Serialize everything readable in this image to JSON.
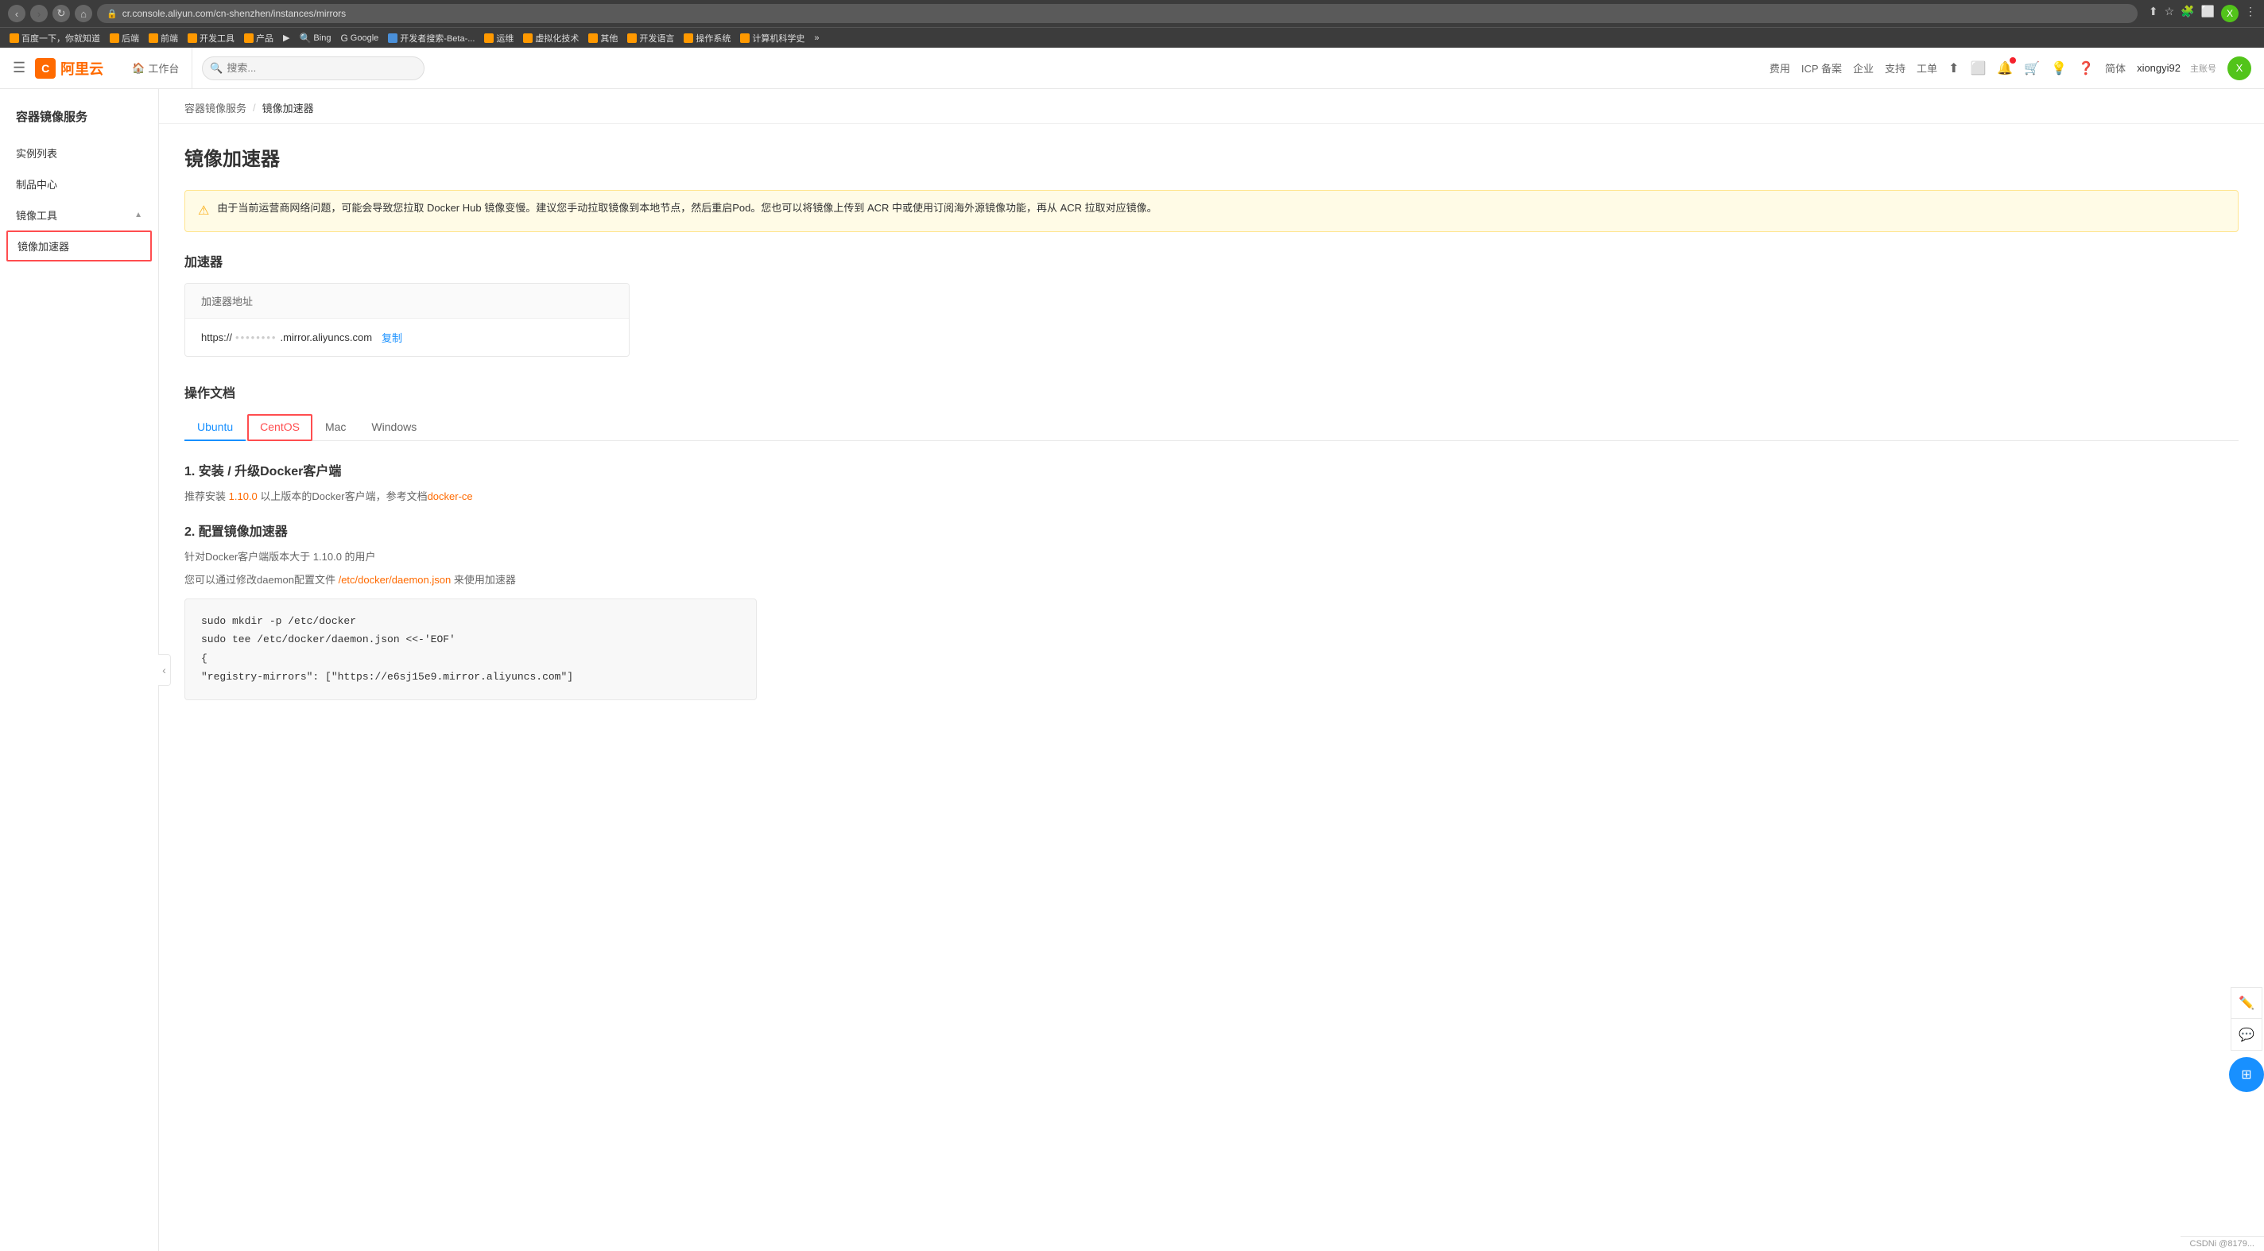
{
  "browser": {
    "url": "cr.console.aliyun.com/cn-shenzhen/instances/mirrors",
    "url_prefix": "cr.console.aliyun.com/cn-shenzhen/instances/mirrors"
  },
  "bookmarks": [
    {
      "label": "百度一下，你就知道",
      "icon": "orange"
    },
    {
      "label": "后端",
      "icon": "orange"
    },
    {
      "label": "前端",
      "icon": "orange"
    },
    {
      "label": "开发工具",
      "icon": "orange"
    },
    {
      "label": "产品",
      "icon": "orange"
    },
    {
      "label": "Bing",
      "icon": "search"
    },
    {
      "label": "Google",
      "icon": "google"
    },
    {
      "label": "开发者搜索-Beta-...",
      "icon": "orange"
    },
    {
      "label": "运维",
      "icon": "orange"
    },
    {
      "label": "虚拟化技术",
      "icon": "orange"
    },
    {
      "label": "其他",
      "icon": "orange"
    },
    {
      "label": "开发语言",
      "icon": "orange"
    },
    {
      "label": "操作系统",
      "icon": "orange"
    },
    {
      "label": "计算机科学史",
      "icon": "orange"
    }
  ],
  "topnav": {
    "home_label": "工作台",
    "search_placeholder": "搜索...",
    "nav_items": [
      "费用",
      "ICP 备案",
      "企业",
      "支持",
      "工单"
    ],
    "user_name": "xiongyi92",
    "user_role": "主账号",
    "lang": "简体"
  },
  "sidebar": {
    "title": "容器镜像服务",
    "items": [
      {
        "label": "实例列表",
        "active": false
      },
      {
        "label": "制品中心",
        "active": false
      },
      {
        "label": "镜像工具",
        "group": true
      },
      {
        "label": "镜像加速器",
        "active": true,
        "sub": true
      }
    ]
  },
  "breadcrumb": {
    "items": [
      "容器镜像服务",
      "镜像加速器"
    ]
  },
  "page": {
    "title": "镜像加速器",
    "alert": {
      "text": "由于当前运营商网络问题，可能会导致您拉取 Docker Hub 镜像变慢。建议您手动拉取镜像到本地节点，然后重启Pod。您也可以将镜像上传到 ACR 中或使用订阅海外源镜像功能，再从 ACR 拉取对应镜像。"
    },
    "accelerator": {
      "section_title": "加速器",
      "address_header": "加速器地址",
      "address_value": "https://",
      "address_masked": "••••••••",
      "address_suffix": ".mirror.aliyuncs.com",
      "copy_label": "复制"
    },
    "docs": {
      "section_title": "操作文档",
      "tabs": [
        "Ubuntu",
        "CentOS",
        "Mac",
        "Windows"
      ],
      "active_tab": "Ubuntu",
      "highlighted_tab": "CentOS",
      "step1": {
        "title": "1. 安装 / 升级Docker客户端",
        "desc_prefix": "推荐安装 ",
        "version_link": "1.10.0",
        "desc_middle": " 以上版本的Docker客户端，参考文档",
        "doc_link": "docker-ce"
      },
      "step2": {
        "title": "2. 配置镜像加速器",
        "desc1": "针对Docker客户端版本大于 1.10.0 的用户",
        "desc2_prefix": "您可以通过修改daemon配置文件 ",
        "config_file": "/etc/docker/daemon.json",
        "desc2_suffix": " 来使用加速器"
      },
      "code": {
        "lines": [
          "sudo mkdir -p /etc/docker",
          "sudo tee /etc/docker/daemon.json <<-'EOF'",
          "{",
          "  \"registry-mirrors\": [\"https://e6sj15e9.mirror.aliyuncs.com\"]"
        ]
      }
    }
  },
  "status_bar": {
    "text1": "CSDNi @8179..."
  }
}
